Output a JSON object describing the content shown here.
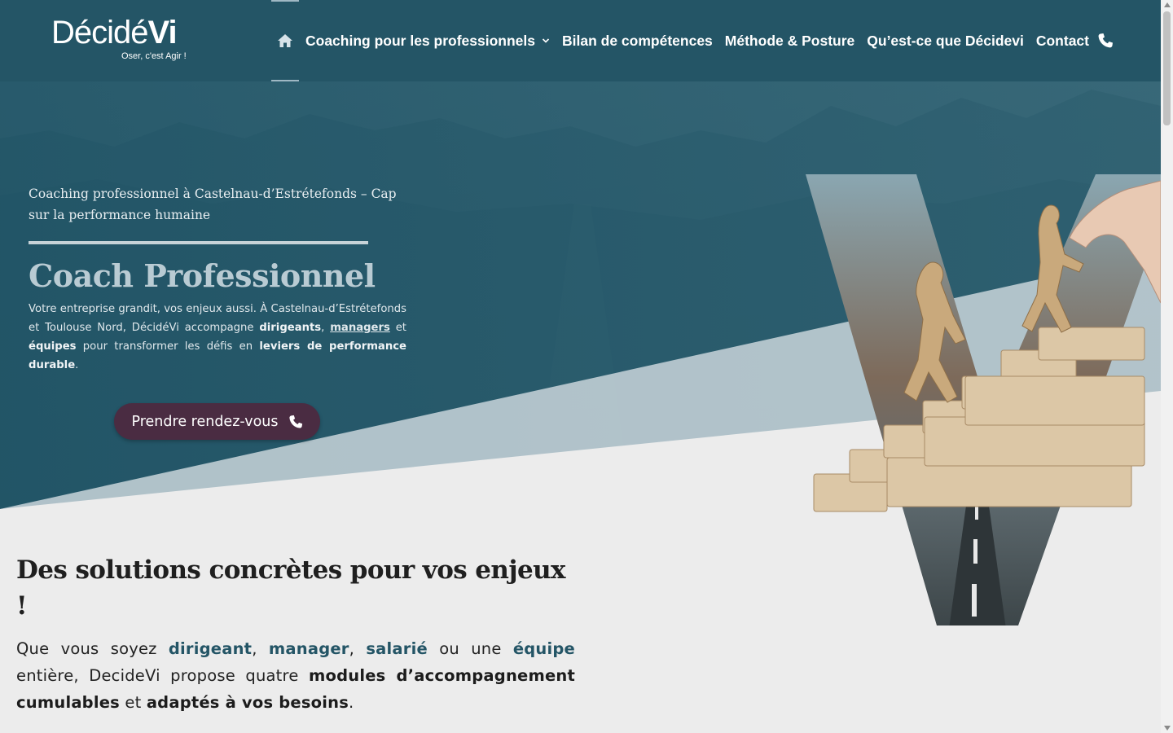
{
  "brand": {
    "name_part1": "Décidé",
    "name_part2": "Vi",
    "tagline": "Oser, c'est Agir !"
  },
  "nav": {
    "home_icon": "home-icon",
    "items": [
      {
        "label": "Coaching pour les professionnels",
        "has_dropdown": true
      },
      {
        "label": "Bilan de compétences"
      },
      {
        "label": "Méthode & Posture"
      },
      {
        "label": "Qu’est-ce que Décidevi"
      },
      {
        "label": "Contact",
        "icon": "phone-icon"
      }
    ]
  },
  "hero": {
    "subtitle": "Coaching professionnel à Castelnau-d’Estrétefonds – Cap sur la performance humaine",
    "title": "Coach Professionnel",
    "desc_1": "Votre entreprise grandit, vos enjeux aussi. À Castelnau-d’Estrétefonds et Toulouse Nord, DécidéVi accompagne ",
    "desc_dirigeants": "dirigeants",
    "desc_sep1": ", ",
    "desc_managers": "managers",
    "desc_et": " et ",
    "desc_equipes": "équipes",
    "desc_2": " pour transformer les défis en ",
    "desc_leviers": "leviers de performance durable",
    "desc_end": ".",
    "cta_label": "Prendre rendez-vous",
    "cta_icon": "phone-icon"
  },
  "section": {
    "title": "Des solutions concrètes pour vos enjeux !",
    "p_start": "Que vous soyez ",
    "dirigeant": "dirigeant",
    "c1": ", ",
    "manager": "manager",
    "c2": ", ",
    "salarie": "salarié",
    "ou_une": " ou une ",
    "equipe": "équipe",
    "p_mid": " entière, DecideVi propose quatre ",
    "modules": "modules d’accompagnement cumulables",
    "et": " et ",
    "adaptes": "adaptés à vos besoins",
    "end": "."
  },
  "colors": {
    "header_bg": "#245566",
    "accent": "#245566",
    "cta_bg": "#4a2c42",
    "page_bg": "#ececec"
  }
}
